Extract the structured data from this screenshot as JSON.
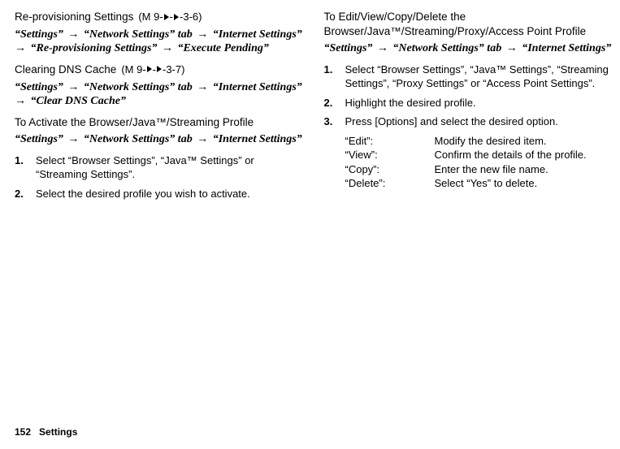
{
  "left": {
    "reprov": {
      "title": "Re-provisioning Settings",
      "code_prefix": "(M 9-",
      "code_suffix": "-3-6)",
      "path_parts": [
        "“Settings”",
        "“Network Settings” tab",
        "“Internet Settings”",
        "“Re-provisioning Settings”",
        "“Execute Pending”"
      ]
    },
    "dns": {
      "title": "Clearing DNS Cache",
      "code_prefix": "(M 9-",
      "code_suffix": "-3-7)",
      "path_parts": [
        "“Settings”",
        "“Network Settings” tab",
        "“Internet Settings”",
        "“Clear DNS Cache”"
      ]
    },
    "activate": {
      "title": "To Activate the Browser/Java™/Streaming Profile",
      "path_parts": [
        "“Settings”",
        "“Network Settings” tab",
        "“Internet Settings”"
      ],
      "steps": [
        "Select “Browser Settings”, “Java™ Settings” or “Streaming Settings”.",
        "Select the desired profile you wish to activate."
      ]
    }
  },
  "right": {
    "editview": {
      "title": "To Edit/View/Copy/Delete the Browser/Java™/Streaming/Proxy/Access Point Profile",
      "path_parts": [
        "“Settings”",
        "“Network Settings” tab",
        "“Internet Settings”"
      ],
      "steps": [
        "Select “Browser Settings”, “Java™ Settings”, “Streaming Settings”, “Proxy Settings” or “Access Point Settings”.",
        "Highlight the desired profile.",
        "Press [Options] and select the desired option."
      ],
      "defs": [
        {
          "term": "“Edit”:",
          "desc": "Modify the desired item."
        },
        {
          "term": "“View”:",
          "desc": "Confirm the details of the profile."
        },
        {
          "term": "“Copy”:",
          "desc": "Enter the new file name."
        },
        {
          "term": "“Delete”:",
          "desc": "Select “Yes” to delete."
        }
      ]
    }
  },
  "footer": {
    "page": "152",
    "section": "Settings"
  }
}
